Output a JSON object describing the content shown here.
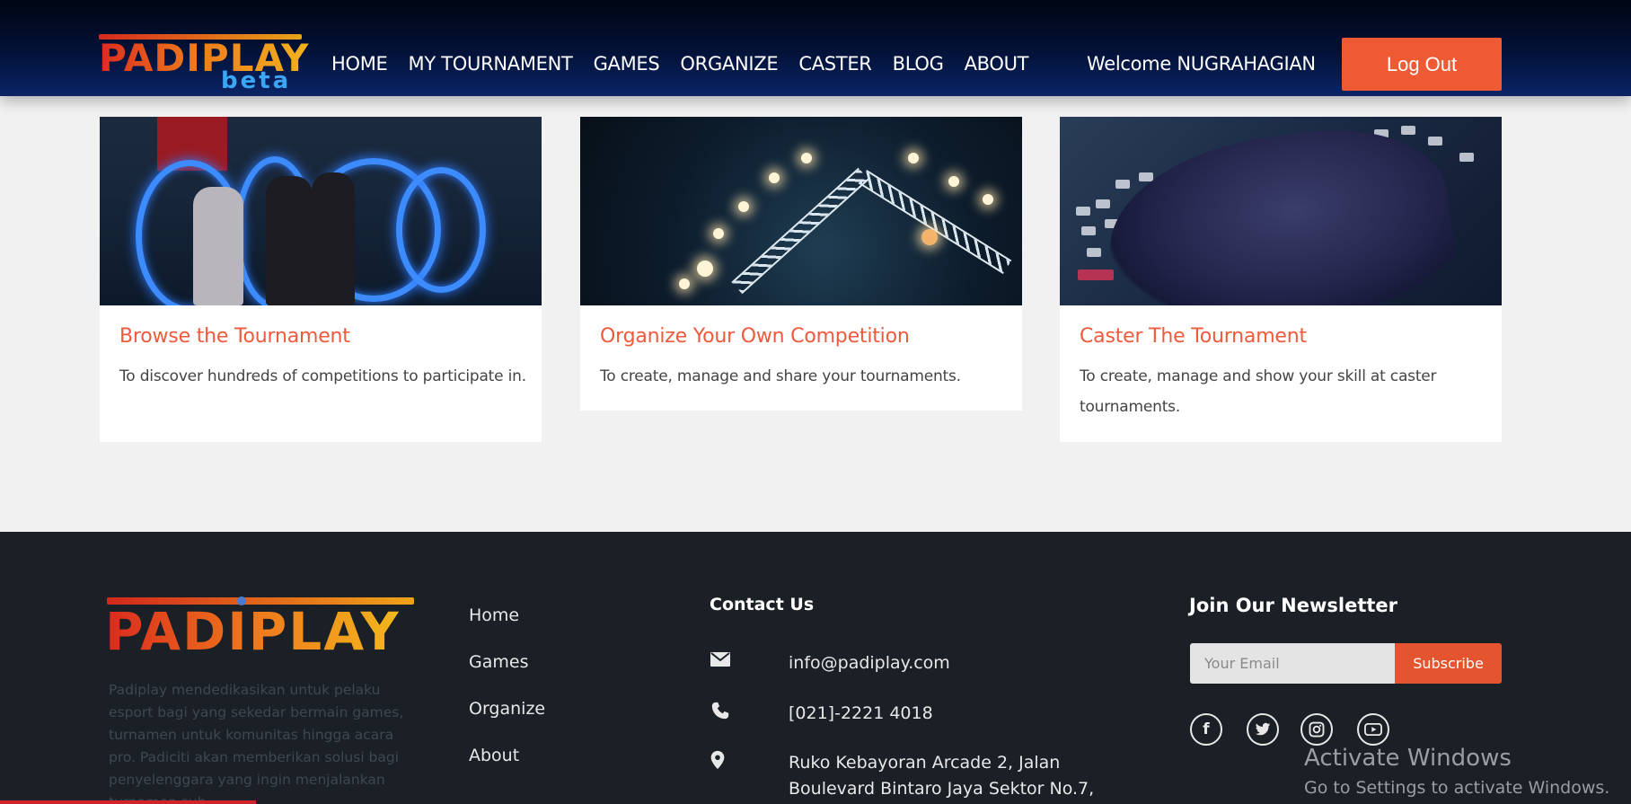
{
  "header": {
    "logo_text": "PADIPLAY",
    "logo_sub": "beta",
    "nav": [
      "HOME",
      "MY TOURNAMENT",
      "GAMES",
      "ORGANIZE",
      "CASTER",
      "BLOG",
      "ABOUT"
    ],
    "welcome": "Welcome NUGRAHAGIAN",
    "logout_label": "Log Out"
  },
  "cards": [
    {
      "title": "Browse the Tournament",
      "description": "To discover hundreds of competitions to participate in."
    },
    {
      "title": "Organize Your Own Competition",
      "description": "To create, manage and share your tournaments."
    },
    {
      "title": "Caster The Tournament",
      "description": "To create, manage and show your skill at caster tournaments."
    }
  ],
  "footer": {
    "logo_text": "PADIPLAY",
    "about": "Padiplay mendedikasikan untuk pelaku esport bagi yang sekedar bermain games, turnamen untuk komunitas hingga acara pro. Padiciti akan memberikan solusi bagi penyelenggara yang ingin menjalankan turnamen sub",
    "links": [
      "Home",
      "Games",
      "Organize",
      "About"
    ],
    "contact_title": "Contact Us",
    "email": "info@padiplay.com",
    "phone": "[021]-2221 4018",
    "address": "Ruko Kebayoran Arcade 2, Jalan Boulevard Bintaro Jaya Sektor No.7,",
    "newsletter_title": "Join Our Newsletter",
    "email_placeholder": "Your Email",
    "subscribe_label": "Subscribe",
    "social_icons": [
      "facebook-icon",
      "twitter-icon",
      "instagram-icon",
      "youtube-icon"
    ]
  },
  "overlay": {
    "activate_title": "Activate Windows",
    "activate_sub": "Go to Settings to activate Windows."
  },
  "colors": {
    "accent": "#ee5a34",
    "header_bg": "#031238",
    "footer_bg": "#1b2026",
    "card_title": "#ee5a3c"
  }
}
